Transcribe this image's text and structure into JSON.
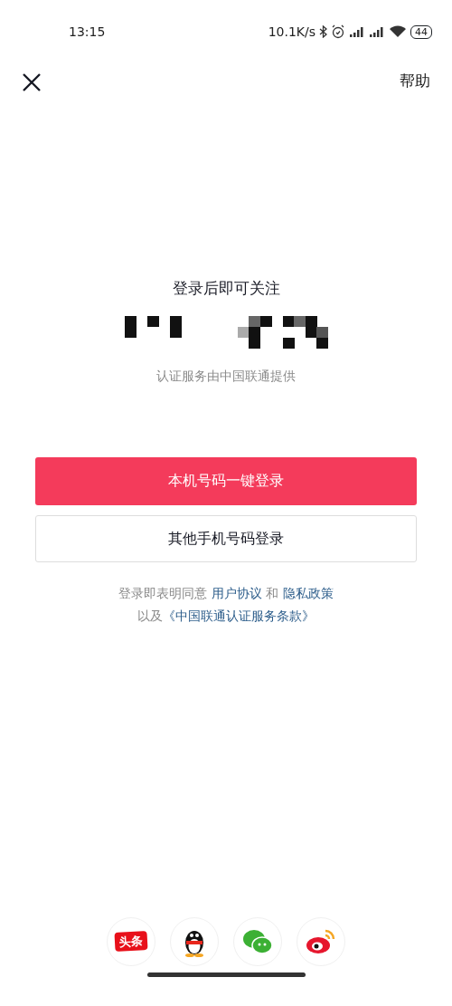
{
  "status_bar": {
    "time": "13:15",
    "speed": "10.1K/s",
    "battery": "44"
  },
  "top_bar": {
    "help": "帮助"
  },
  "title": "登录后即可关注",
  "provider": "认证服务由中国联通提供",
  "buttons": [
    {
      "label": "本机号码一键登录",
      "kind": "primary"
    },
    {
      "label": "其他手机号码登录",
      "kind": "outline"
    }
  ],
  "agreement": {
    "line_1": [
      {
        "text": "登录即表明同意 ",
        "kind": "plain"
      },
      {
        "text": "用户协议",
        "kind": "link"
      },
      {
        "text": " 和 ",
        "kind": "plain"
      },
      {
        "text": "隐私政策",
        "kind": "link"
      }
    ],
    "line_2": [
      {
        "text": "以及",
        "kind": "plain"
      },
      {
        "text": "《中国联通认证服务条款》",
        "kind": "link"
      }
    ]
  },
  "social_logins": [
    {
      "kind": "toutiao",
      "label": "头条"
    },
    {
      "kind": "qq"
    },
    {
      "kind": "wechat"
    },
    {
      "kind": "weibo"
    }
  ]
}
